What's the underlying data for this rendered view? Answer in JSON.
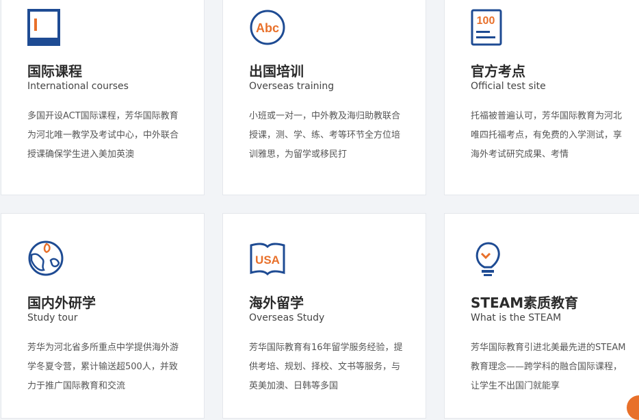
{
  "colors": {
    "icon_blue": "#1e4b93",
    "icon_orange": "#e8702a",
    "page_background": "#f2f4f7",
    "card_background": "#ffffff"
  },
  "cards": [
    {
      "icon": "book-icon",
      "title": "国际课程",
      "subtitle": "International courses",
      "description": "多国开设ACT国际课程，芳华国际教育为河北唯一教学及考试中心，中外联合授课确保学生进入美加英澳"
    },
    {
      "icon": "abc-circle-icon",
      "icon_text": "Abc",
      "title": "出国培训",
      "subtitle": "Overseas training",
      "description": "小班或一对一，中外教及海归助教联合授课，测、学、练、考等环节全方位培训雅思，为留学或移民打"
    },
    {
      "icon": "score-sheet-icon",
      "icon_text": "100",
      "title": "官方考点",
      "subtitle": "Official test site",
      "description": "托福被普遍认可，芳华国际教育为河北唯四托福考点，有免费的入学测试，享海外考试研究成果、考情"
    },
    {
      "icon": "globe-icon",
      "title": "国内外研学",
      "subtitle": "Study tour",
      "description": "芳华为河北省多所重点中学提供海外游学冬夏令营，累计输送超500人，并致力于推广国际教育和交流"
    },
    {
      "icon": "usa-book-icon",
      "icon_text": "USA",
      "title": "海外留学",
      "subtitle": "Overseas Study",
      "description": "芳华国际教育有16年留学服务经验，提供考培、规划、择校、文书等服务，与英美加澳、日韩等多国"
    },
    {
      "icon": "lightbulb-icon",
      "title": "STEAM素质教育",
      "subtitle": "What is the STEAM",
      "description": "芳华国际教育引进北美最先进的STEAM教育理念——跨学科的融合国际课程，让学生不出国门就能享"
    }
  ]
}
